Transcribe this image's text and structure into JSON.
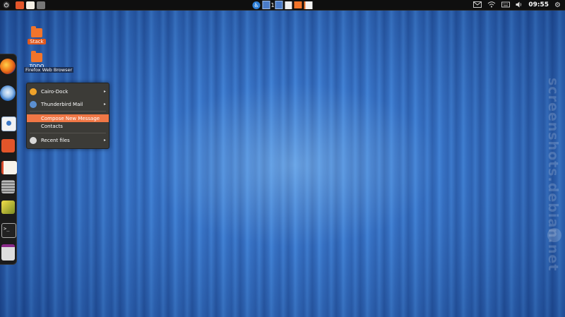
{
  "top_panel": {
    "clock": "09:55",
    "workspace_number": "1"
  },
  "desktop_icons": [
    {
      "label": "Stack",
      "icon": "folder-icon"
    },
    {
      "label": "TODO",
      "icon": "folder-icon"
    }
  ],
  "dock": {
    "tooltip": "Firefox Web Browser",
    "items": [
      "firefox-icon",
      "thunderbird-icon",
      "mail-compose-icon",
      "folder-icon",
      "document-icon",
      "calculator-icon",
      "image-viewer-icon",
      "terminal-icon",
      "window-icon"
    ]
  },
  "context_menu": {
    "items": [
      {
        "label": "Cairo-Dock",
        "submenu": true
      },
      {
        "label": "Thunderbird Mail",
        "submenu": true
      },
      {
        "label": "Compose New Message",
        "highlighted": true
      },
      {
        "label": "Contacts"
      },
      {
        "label": "Recent files",
        "submenu": true
      }
    ]
  },
  "watermark": "screenshots.debian.net",
  "colors": {
    "accent": "#f07746",
    "menu_bg": "#3c3b37",
    "panel_bg": "#0f0f0f"
  }
}
